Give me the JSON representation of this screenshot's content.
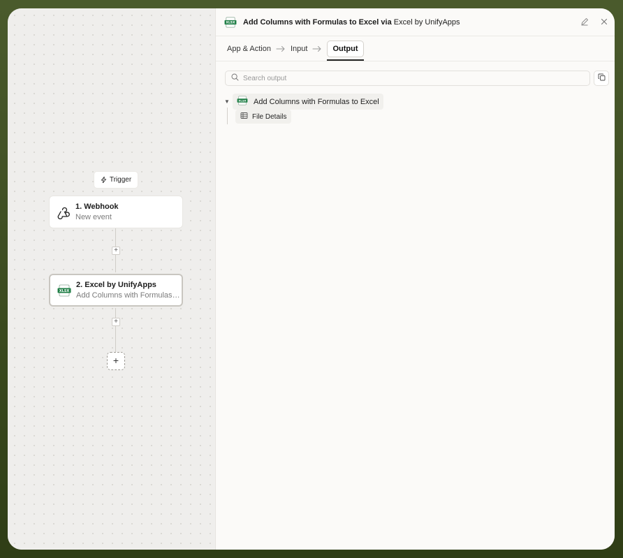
{
  "canvas": {
    "trigger_label": "Trigger",
    "nodes": [
      {
        "title": "1. Webhook",
        "subtitle": "New event",
        "icon": "webhook-icon"
      },
      {
        "title": "2. Excel by UnifyApps",
        "subtitle": "Add Columns with Formulas to Excel",
        "icon": "xlsx-icon"
      }
    ],
    "add_step_label": "+"
  },
  "panel": {
    "title_action": "Add Columns with Formulas to Excel",
    "title_via": "via",
    "title_app": "Excel by UnifyApps",
    "tabs": [
      {
        "label": "App & Action"
      },
      {
        "label": "Input"
      },
      {
        "label": "Output"
      }
    ],
    "active_tab": "Output",
    "search": {
      "placeholder": "Search output",
      "value": ""
    },
    "tree": {
      "root_label": "Add Columns with Formulas to Excel",
      "children": [
        {
          "label": "File Details",
          "icon": "table-icon"
        }
      ]
    }
  },
  "colors": {
    "excel_green": "#1e7e45",
    "outer_bg": "#3d4c20"
  }
}
